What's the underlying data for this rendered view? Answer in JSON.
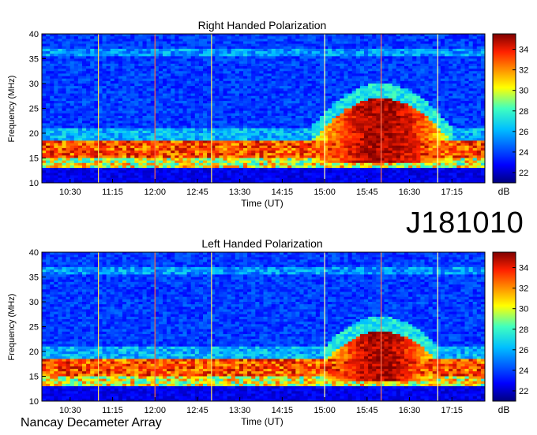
{
  "observation_id": "J181010",
  "credit": "Nancay Decameter Array",
  "colorbar": {
    "unit": "dB",
    "ticks": [
      22,
      24,
      26,
      28,
      30,
      32,
      34
    ],
    "range": [
      21,
      35.5
    ]
  },
  "chart_data": [
    {
      "type": "heatmap",
      "title": "Right Handed Polarization",
      "xlabel": "Time (UT)",
      "ylabel": "Frequency (MHz)",
      "x_ticks": [
        "10:30",
        "11:15",
        "12:00",
        "12:45",
        "13:30",
        "14:15",
        "15:00",
        "15:45",
        "16:30",
        "17:15"
      ],
      "y_ticks": [
        10,
        15,
        20,
        25,
        30,
        35,
        40
      ],
      "ylim": [
        10,
        40
      ],
      "xlim": [
        "10:00",
        "17:50"
      ],
      "colorbar_label": "dB",
      "features": [
        {
          "band_mhz": [
            15,
            18.5
          ],
          "level_db": 34,
          "note": "persistent low-frequency band"
        },
        {
          "time_range": [
            "14:45",
            "17:15"
          ],
          "freq_mhz": [
            14,
            27
          ],
          "level_db": 33,
          "note": "Jovian decametric emission"
        }
      ]
    },
    {
      "type": "heatmap",
      "title": "Left Handed Polarization",
      "xlabel": "Time (UT)",
      "ylabel": "Frequency (MHz)",
      "x_ticks": [
        "10:30",
        "11:15",
        "12:00",
        "12:45",
        "13:30",
        "14:15",
        "15:00",
        "15:45",
        "16:30",
        "17:15"
      ],
      "y_ticks": [
        10,
        15,
        20,
        25,
        30,
        35,
        40
      ],
      "ylim": [
        10,
        40
      ],
      "xlim": [
        "10:00",
        "17:50"
      ],
      "colorbar_label": "dB",
      "features": [
        {
          "band_mhz": [
            15,
            18.5
          ],
          "level_db": 34,
          "note": "persistent low-frequency band"
        },
        {
          "time_range": [
            "15:00",
            "17:00"
          ],
          "freq_mhz": [
            14,
            24
          ],
          "level_db": 33,
          "note": "Jovian decametric emission"
        }
      ]
    }
  ]
}
